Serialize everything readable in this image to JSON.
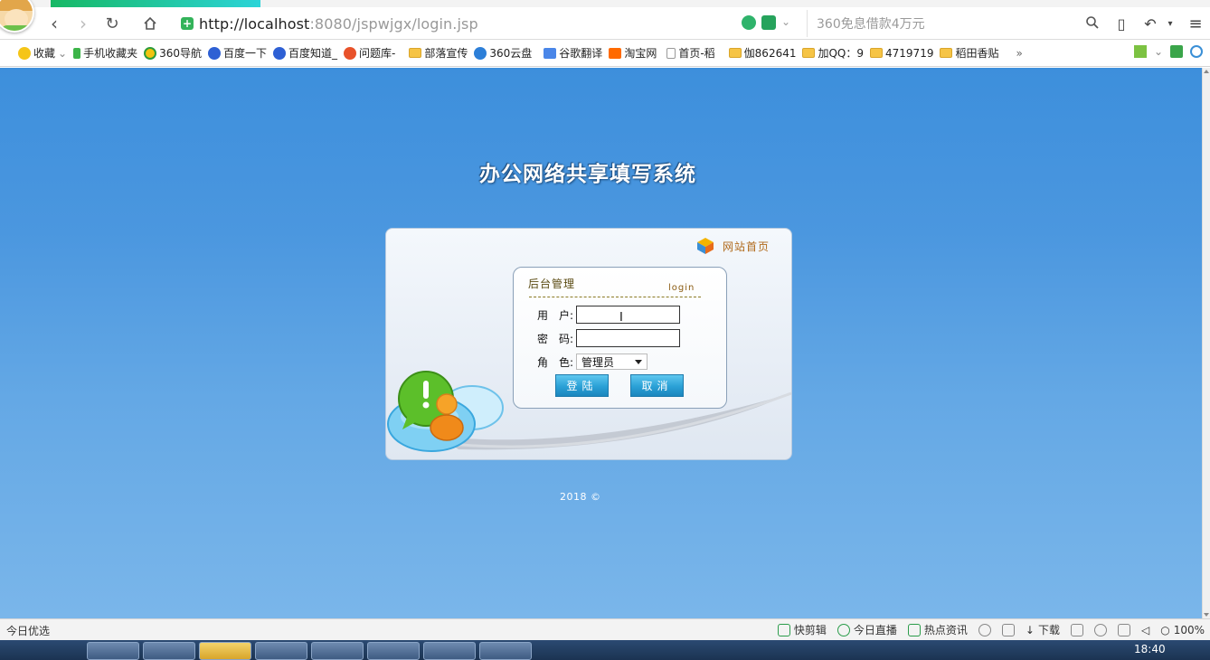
{
  "browser": {
    "url_host": "http://localhost",
    "url_rest": ":8080/jspwjgx/login.jsp",
    "search_placeholder": "360免息借款4万元"
  },
  "bookmarks": [
    {
      "label": "收藏",
      "icon": "star-icon"
    },
    {
      "label": "手机收藏夹",
      "icon": "phone-icon"
    },
    {
      "label": "360导航",
      "icon": "nav360-icon"
    },
    {
      "label": "百度一下",
      "icon": "baidu-icon"
    },
    {
      "label": "百度知道_",
      "icon": "baidu-icon"
    },
    {
      "label": "问题库-",
      "icon": "s-icon"
    },
    {
      "label": "部落宣传",
      "icon": "folder-icon"
    },
    {
      "label": "360云盘",
      "icon": "cloud-icon"
    },
    {
      "label": "谷歌翻译",
      "icon": "translate-icon"
    },
    {
      "label": "淘宝网",
      "icon": "taobao-icon"
    },
    {
      "label": "首页-稻",
      "icon": "page-icon"
    },
    {
      "label": "伽862641",
      "icon": "folder-icon"
    },
    {
      "label": "加QQ：9",
      "icon": "folder-icon"
    },
    {
      "label": "4719719",
      "icon": "folder-icon"
    },
    {
      "label": "稻田香贴",
      "icon": "folder-icon"
    }
  ],
  "bookmarks_more": "»",
  "page": {
    "title": "办公网络共享填写系统",
    "home_link": "网站首页",
    "form_heading": "后台管理",
    "form_login_tag": "login",
    "username_label": "用　户:",
    "password_label": "密　码:",
    "role_label": "角　色:",
    "role_value": "管理员",
    "submit_label": "登陆",
    "cancel_label": "取消",
    "footer": "2018 ©"
  },
  "statusbar": {
    "left": "今日优选",
    "items": [
      "快剪辑",
      "今日直播",
      "热点资讯",
      "下载"
    ],
    "zoom": "100%"
  },
  "taskbar": {
    "clock": "18:40"
  }
}
